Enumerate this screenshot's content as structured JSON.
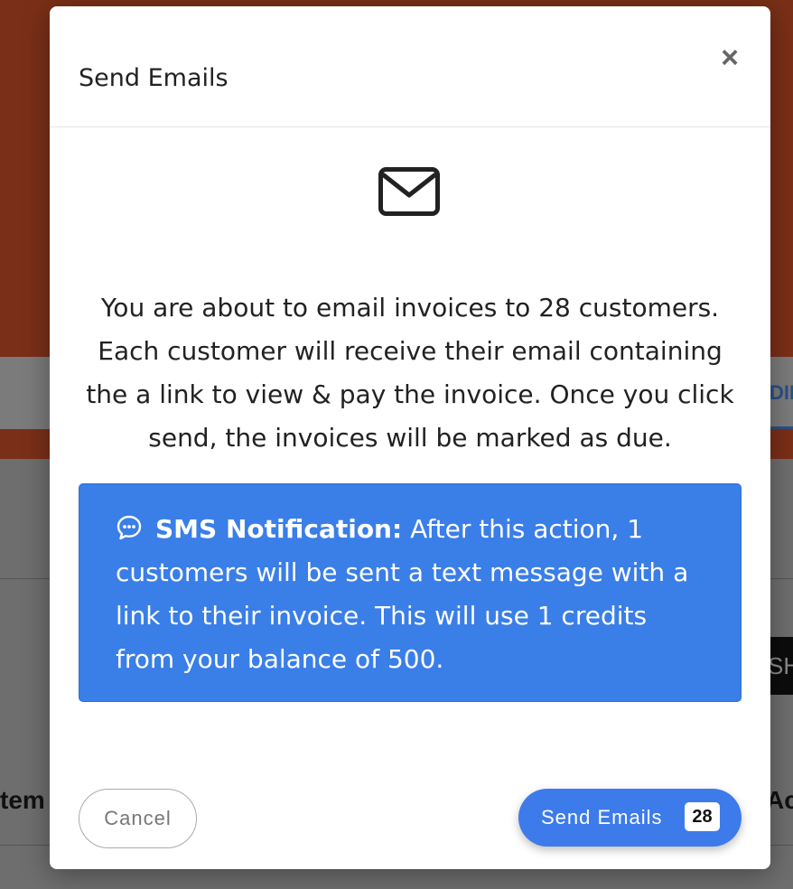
{
  "background": {
    "tab_fragment": "DIN",
    "button_fragment": "SH",
    "left_column_fragment": "tem",
    "right_column_fragment": "Act"
  },
  "modal": {
    "title": "Send Emails",
    "close_icon": "close-icon",
    "envelope_icon": "envelope-icon",
    "message": "You are about to email invoices to 28 customers. Each customer will receive their email containing the a link to view & pay the invoice. Once you click send, the invoices will be marked as due.",
    "sms": {
      "icon": "chat-bubble-icon",
      "title": "SMS Notification:",
      "body": "After this action, 1 customers will be sent a text message with a link to their invoice. This will use 1 credits from your balance of 500.",
      "color": "#3a7ee8"
    },
    "cancel_label": "Cancel",
    "send_label": "Send Emails",
    "send_count": "28",
    "accent_color": "#3d7bea"
  }
}
